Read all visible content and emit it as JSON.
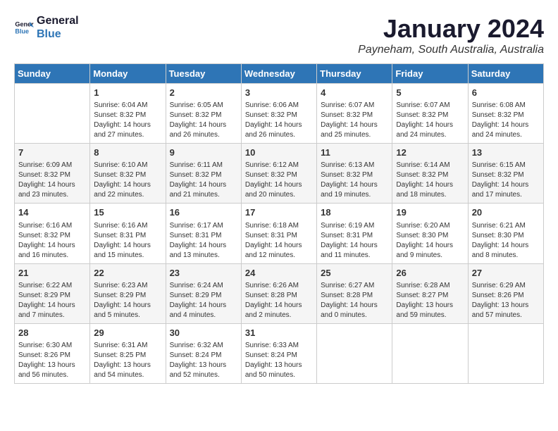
{
  "logo": {
    "line1": "General",
    "line2": "Blue"
  },
  "title": "January 2024",
  "location": "Payneham, South Australia, Australia",
  "headers": [
    "Sunday",
    "Monday",
    "Tuesday",
    "Wednesday",
    "Thursday",
    "Friday",
    "Saturday"
  ],
  "weeks": [
    [
      {
        "day": "",
        "info": ""
      },
      {
        "day": "1",
        "info": "Sunrise: 6:04 AM\nSunset: 8:32 PM\nDaylight: 14 hours\nand 27 minutes."
      },
      {
        "day": "2",
        "info": "Sunrise: 6:05 AM\nSunset: 8:32 PM\nDaylight: 14 hours\nand 26 minutes."
      },
      {
        "day": "3",
        "info": "Sunrise: 6:06 AM\nSunset: 8:32 PM\nDaylight: 14 hours\nand 26 minutes."
      },
      {
        "day": "4",
        "info": "Sunrise: 6:07 AM\nSunset: 8:32 PM\nDaylight: 14 hours\nand 25 minutes."
      },
      {
        "day": "5",
        "info": "Sunrise: 6:07 AM\nSunset: 8:32 PM\nDaylight: 14 hours\nand 24 minutes."
      },
      {
        "day": "6",
        "info": "Sunrise: 6:08 AM\nSunset: 8:32 PM\nDaylight: 14 hours\nand 24 minutes."
      }
    ],
    [
      {
        "day": "7",
        "info": "Sunrise: 6:09 AM\nSunset: 8:32 PM\nDaylight: 14 hours\nand 23 minutes."
      },
      {
        "day": "8",
        "info": "Sunrise: 6:10 AM\nSunset: 8:32 PM\nDaylight: 14 hours\nand 22 minutes."
      },
      {
        "day": "9",
        "info": "Sunrise: 6:11 AM\nSunset: 8:32 PM\nDaylight: 14 hours\nand 21 minutes."
      },
      {
        "day": "10",
        "info": "Sunrise: 6:12 AM\nSunset: 8:32 PM\nDaylight: 14 hours\nand 20 minutes."
      },
      {
        "day": "11",
        "info": "Sunrise: 6:13 AM\nSunset: 8:32 PM\nDaylight: 14 hours\nand 19 minutes."
      },
      {
        "day": "12",
        "info": "Sunrise: 6:14 AM\nSunset: 8:32 PM\nDaylight: 14 hours\nand 18 minutes."
      },
      {
        "day": "13",
        "info": "Sunrise: 6:15 AM\nSunset: 8:32 PM\nDaylight: 14 hours\nand 17 minutes."
      }
    ],
    [
      {
        "day": "14",
        "info": "Sunrise: 6:16 AM\nSunset: 8:32 PM\nDaylight: 14 hours\nand 16 minutes."
      },
      {
        "day": "15",
        "info": "Sunrise: 6:16 AM\nSunset: 8:31 PM\nDaylight: 14 hours\nand 15 minutes."
      },
      {
        "day": "16",
        "info": "Sunrise: 6:17 AM\nSunset: 8:31 PM\nDaylight: 14 hours\nand 13 minutes."
      },
      {
        "day": "17",
        "info": "Sunrise: 6:18 AM\nSunset: 8:31 PM\nDaylight: 14 hours\nand 12 minutes."
      },
      {
        "day": "18",
        "info": "Sunrise: 6:19 AM\nSunset: 8:31 PM\nDaylight: 14 hours\nand 11 minutes."
      },
      {
        "day": "19",
        "info": "Sunrise: 6:20 AM\nSunset: 8:30 PM\nDaylight: 14 hours\nand 9 minutes."
      },
      {
        "day": "20",
        "info": "Sunrise: 6:21 AM\nSunset: 8:30 PM\nDaylight: 14 hours\nand 8 minutes."
      }
    ],
    [
      {
        "day": "21",
        "info": "Sunrise: 6:22 AM\nSunset: 8:29 PM\nDaylight: 14 hours\nand 7 minutes."
      },
      {
        "day": "22",
        "info": "Sunrise: 6:23 AM\nSunset: 8:29 PM\nDaylight: 14 hours\nand 5 minutes."
      },
      {
        "day": "23",
        "info": "Sunrise: 6:24 AM\nSunset: 8:29 PM\nDaylight: 14 hours\nand 4 minutes."
      },
      {
        "day": "24",
        "info": "Sunrise: 6:26 AM\nSunset: 8:28 PM\nDaylight: 14 hours\nand 2 minutes."
      },
      {
        "day": "25",
        "info": "Sunrise: 6:27 AM\nSunset: 8:28 PM\nDaylight: 14 hours\nand 0 minutes."
      },
      {
        "day": "26",
        "info": "Sunrise: 6:28 AM\nSunset: 8:27 PM\nDaylight: 13 hours\nand 59 minutes."
      },
      {
        "day": "27",
        "info": "Sunrise: 6:29 AM\nSunset: 8:26 PM\nDaylight: 13 hours\nand 57 minutes."
      }
    ],
    [
      {
        "day": "28",
        "info": "Sunrise: 6:30 AM\nSunset: 8:26 PM\nDaylight: 13 hours\nand 56 minutes."
      },
      {
        "day": "29",
        "info": "Sunrise: 6:31 AM\nSunset: 8:25 PM\nDaylight: 13 hours\nand 54 minutes."
      },
      {
        "day": "30",
        "info": "Sunrise: 6:32 AM\nSunset: 8:24 PM\nDaylight: 13 hours\nand 52 minutes."
      },
      {
        "day": "31",
        "info": "Sunrise: 6:33 AM\nSunset: 8:24 PM\nDaylight: 13 hours\nand 50 minutes."
      },
      {
        "day": "",
        "info": ""
      },
      {
        "day": "",
        "info": ""
      },
      {
        "day": "",
        "info": ""
      }
    ]
  ]
}
